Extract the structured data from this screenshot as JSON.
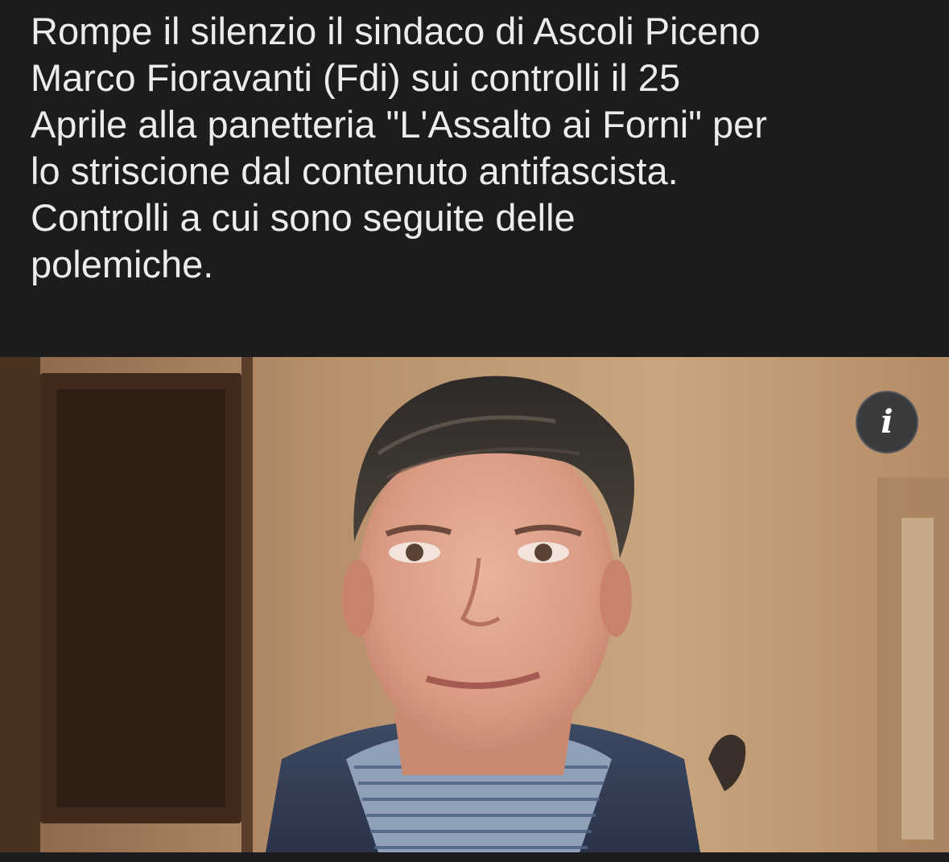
{
  "post": {
    "caption_lines": [
      "Rompe il silenzio il sindaco di Ascoli Piceno",
      "Marco Fioravanti (Fdi) sui controlli il 25",
      "Aprile alla panetteria \"L'Assalto ai Forni\" per",
      "lo striscione dal contenuto antifascista.",
      "Controlli a cui sono seguite delle",
      "polemiche."
    ],
    "info_icon": "info-icon",
    "info_glyph": "i"
  },
  "colors": {
    "background": "#1c1c1e",
    "caption_text": "#ececec",
    "info_button_bg": "#3a3b3d"
  }
}
